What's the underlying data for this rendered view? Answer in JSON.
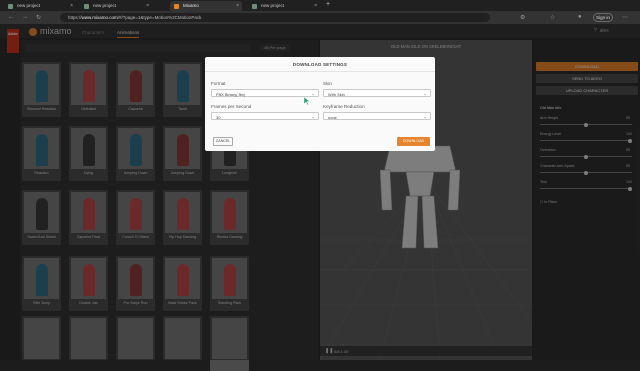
{
  "browser": {
    "tabs": [
      {
        "label": "new project",
        "favicon_color": "#6b8f7a"
      },
      {
        "label": "new project",
        "favicon_color": "#6b8f7a"
      },
      {
        "label": "Mixamo",
        "favicon_color": "#e6842d"
      },
      {
        "label": "new project",
        "favicon_color": "#6b8f7a"
      }
    ],
    "new_tab": "+",
    "url_prefix": "https://",
    "url_host": "www.mixamo.com",
    "url_path": "/#/?page=1&type=Motion%2CMotionPack",
    "sign_in": "Sign in"
  },
  "app": {
    "adobe_label": "Adobe",
    "logo": "mixamo",
    "nav_tabs": [
      "Characters",
      "Animations"
    ],
    "per_page": "48 Per page",
    "user": "alex",
    "viewport_title": "OLD MAN IDLE ON SKELEBKNIGHT",
    "timeline_frame": "0/8.1:30"
  },
  "animations": [
    {
      "label": "Silenced Reaction",
      "color": "#2f6d86"
    },
    {
      "label": "Defeated",
      "color": "#b84848"
    },
    {
      "label": "Capoeira",
      "color": "#8b3a3a"
    },
    {
      "label": "Taunt",
      "color": "#2f6d86"
    },
    {
      "label": "Reaction",
      "color": "#2f6d86"
    },
    {
      "label": "Dying",
      "color": "#3a3a3a"
    },
    {
      "label": "Jumping Down",
      "color": "#2f6d86"
    },
    {
      "label": "Jumping Down",
      "color": "#8b3a3a"
    },
    {
      "label": "Sword And Shield",
      "color": "#3a3a3a"
    },
    {
      "label": "Capoeira Pack",
      "color": "#b84848"
    },
    {
      "label": "Crouch To Stand",
      "color": "#b84848"
    },
    {
      "label": "Hip Hop Dancing",
      "color": "#b84848"
    },
    {
      "label": "Rifle Jump",
      "color": "#2f6d86"
    },
    {
      "label": "Double Jab",
      "color": "#b84848"
    },
    {
      "label": "Pro Swipe Run",
      "color": "#8b3a3a"
    },
    {
      "label": "Back Stroke Pack",
      "color": "#b84848"
    }
  ],
  "animations_col5": [
    {
      "label": "Longbow",
      "color": "#3a3a3a"
    },
    {
      "label": "Rumba Dancing",
      "color": "#b84848"
    },
    {
      "label": "Standing Pack",
      "color": "#b84848"
    },
    {
      "label": "",
      "color": "#b84848"
    }
  ],
  "right_panel": {
    "download": "DOWNLOAD",
    "send_to_aero": "SEND TO AERO",
    "upload_character": "UPLOAD CHARACTER",
    "section": "Old Man Idle",
    "params": [
      {
        "label": "Arm Height",
        "value": "50",
        "level": 0.5
      },
      {
        "label": "Energy Level",
        "value": "100",
        "level": 1.0
      },
      {
        "label": "Overdrive",
        "value": "50",
        "level": 0.5
      },
      {
        "label": "Character Arm-Space",
        "value": "50",
        "level": 0.5
      },
      {
        "label": "Trim",
        "value": "100",
        "level": 1.0
      }
    ],
    "in_place": "In Place"
  },
  "modal": {
    "title": "DOWNLOAD SETTINGS",
    "format_label": "Format",
    "format_value": "FBX Binary(.fbx)",
    "skin_label": "Skin",
    "skin_value": "With Skin",
    "fps_label": "Frames per Second",
    "fps_value": "30",
    "keyframe_label": "Keyframe Reduction",
    "keyframe_value": "none",
    "cancel": "CANCEL",
    "download": "DOWNLOAD"
  },
  "colors": {
    "accent": "#e6842d",
    "adobe_red": "#c8341f"
  }
}
